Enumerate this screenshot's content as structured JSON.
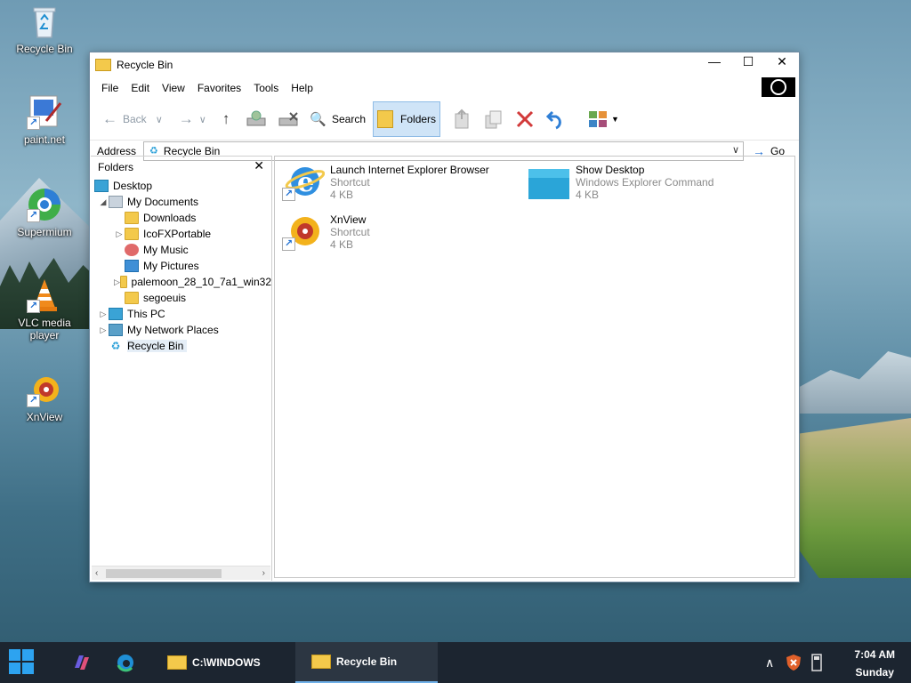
{
  "desktop": {
    "icons": [
      {
        "label": "Recycle Bin"
      },
      {
        "label": "paint.net"
      },
      {
        "label": "Supermium"
      },
      {
        "label": "VLC media player"
      },
      {
        "label": "XnView"
      }
    ]
  },
  "window": {
    "title": "Recycle Bin",
    "controls": {
      "minimize": "—",
      "maximize": "☐",
      "close": "✕"
    },
    "menu": [
      "File",
      "Edit",
      "View",
      "Favorites",
      "Tools",
      "Help"
    ],
    "toolbar": {
      "back": "Back",
      "search": "Search",
      "folders": "Folders"
    },
    "address": {
      "label": "Address",
      "value": "Recycle Bin",
      "go": "Go"
    },
    "folders_pane": {
      "title": "Folders",
      "close": "✕",
      "tree": [
        {
          "label": "Desktop"
        },
        {
          "label": "My Documents"
        },
        {
          "label": "Downloads"
        },
        {
          "label": "IcoFXPortable"
        },
        {
          "label": "My Music"
        },
        {
          "label": "My Pictures"
        },
        {
          "label": "palemoon_28_10_7a1_win32"
        },
        {
          "label": "segoeuis"
        },
        {
          "label": "This PC"
        },
        {
          "label": "My Network Places"
        },
        {
          "label": "Recycle Bin"
        }
      ]
    },
    "files": [
      {
        "name": "Launch Internet Explorer Browser",
        "type": "Shortcut",
        "size": "4 KB"
      },
      {
        "name": "Show Desktop",
        "type": "Windows Explorer Command",
        "size": "4 KB"
      },
      {
        "name": "XnView",
        "type": "Shortcut",
        "size": "4 KB"
      }
    ]
  },
  "taskbar": {
    "items": [
      {
        "label": "C:\\WINDOWS"
      },
      {
        "label": "Recycle Bin"
      }
    ],
    "time": "7:04 AM",
    "day": "Sunday"
  }
}
